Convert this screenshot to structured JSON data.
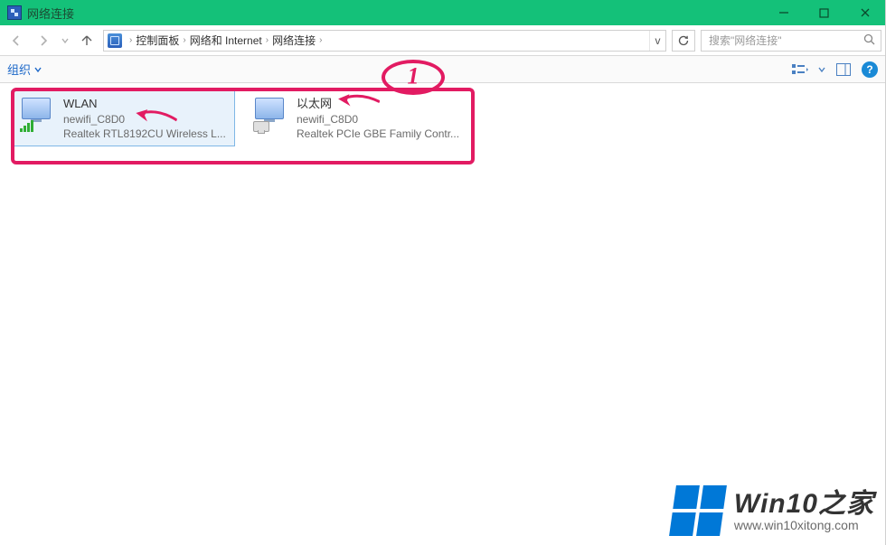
{
  "window": {
    "title": "网络连接"
  },
  "breadcrumb": {
    "items": [
      "控制面板",
      "网络和 Internet",
      "网络连接"
    ]
  },
  "search": {
    "placeholder": "搜索\"网络连接\""
  },
  "toolbar": {
    "organize": "组织"
  },
  "connections": [
    {
      "name": "WLAN",
      "ssid": "newifi_C8D0",
      "adapter": "Realtek RTL8192CU Wireless L...",
      "type": "wifi",
      "selected": true
    },
    {
      "name": "以太网",
      "ssid": "newifi_C8D0",
      "adapter": "Realtek PCIe GBE Family Contr...",
      "type": "ethernet",
      "selected": false
    }
  ],
  "annotation": {
    "marker": "1"
  },
  "watermark": {
    "title": "Win10之家",
    "url": "www.win10xitong.com"
  },
  "icons": {
    "back": "←",
    "forward": "→",
    "up": "↑",
    "dropdown": "▾",
    "refresh": "⟳",
    "search": "🔍",
    "help": "?",
    "minimize": "—",
    "maximize": "☐",
    "close": "✕"
  },
  "colors": {
    "accent": "#14c179",
    "annotation": "#e21b62",
    "win_blue": "#0078d7"
  }
}
